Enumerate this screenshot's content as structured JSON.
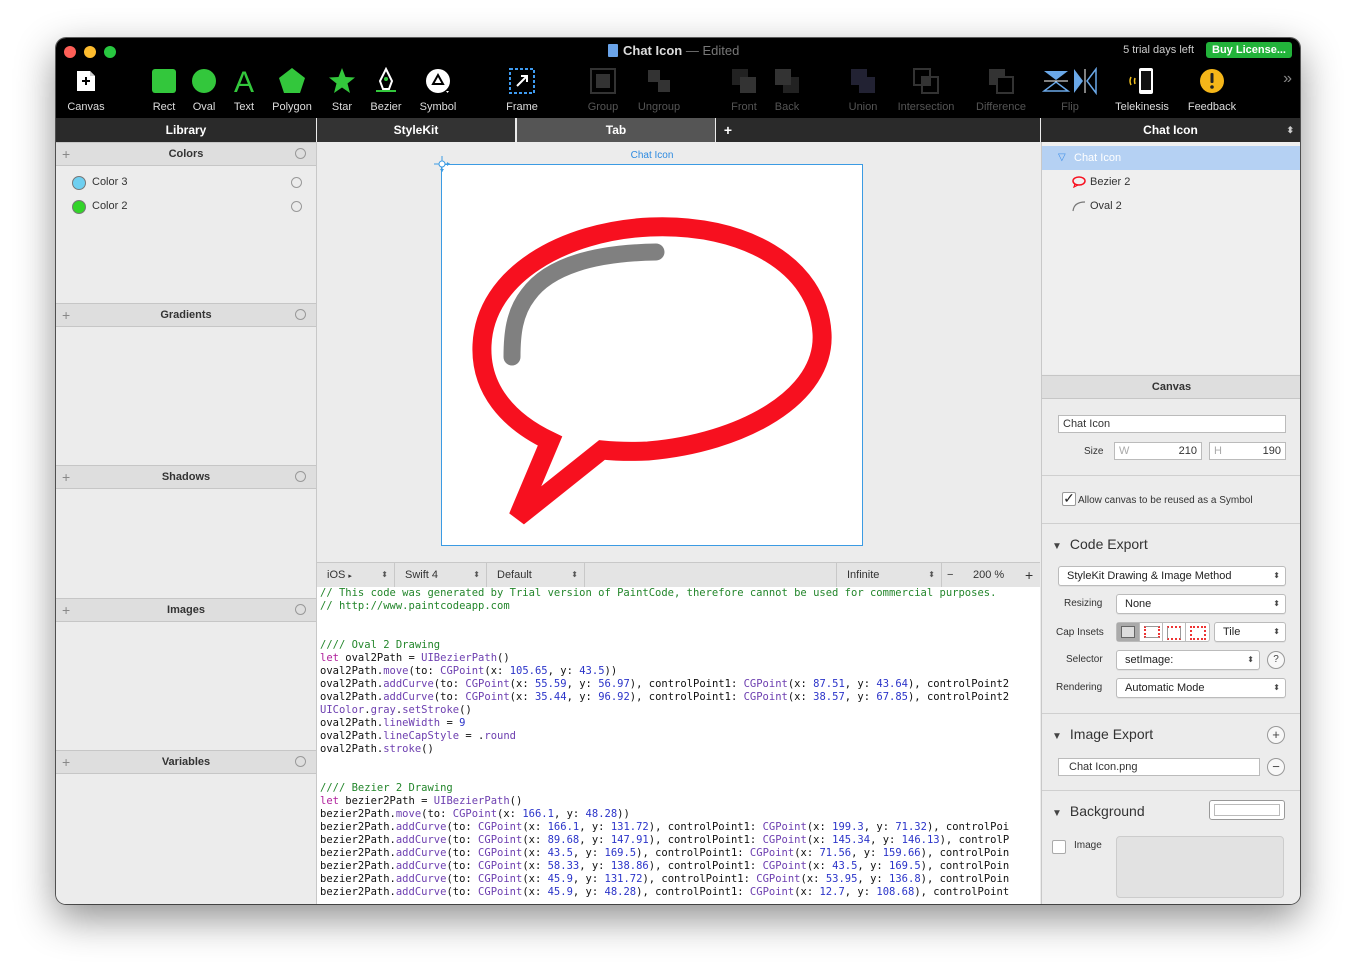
{
  "window": {
    "title": "Chat Icon",
    "title_sep": "—",
    "edited": "Edited",
    "trial": "5 trial days left",
    "buy": "Buy License..."
  },
  "toolbar": {
    "tools": [
      {
        "label": "Canvas",
        "icon": "canvas-icon"
      },
      {
        "label": "Rect",
        "icon": "rect-icon"
      },
      {
        "label": "Oval",
        "icon": "oval-icon"
      },
      {
        "label": "Text",
        "icon": "text-icon"
      },
      {
        "label": "Polygon",
        "icon": "polygon-icon"
      },
      {
        "label": "Star",
        "icon": "star-icon"
      },
      {
        "label": "Bezier",
        "icon": "bezier-pen-icon"
      },
      {
        "label": "Symbol",
        "icon": "symbol-icon"
      },
      {
        "label": "Frame",
        "icon": "frame-icon"
      },
      {
        "label": "Group",
        "icon": "group-icon"
      },
      {
        "label": "Ungroup",
        "icon": "ungroup-icon"
      },
      {
        "label": "Front",
        "icon": "bring-front-icon"
      },
      {
        "label": "Back",
        "icon": "send-back-icon"
      },
      {
        "label": "Union",
        "icon": "union-icon"
      },
      {
        "label": "Intersection",
        "icon": "intersection-icon"
      },
      {
        "label": "Difference",
        "icon": "difference-icon"
      },
      {
        "label": "Flip",
        "icon": "flip-icon"
      },
      {
        "label": "Telekinesis",
        "icon": "telekinesis-icon"
      },
      {
        "label": "Feedback",
        "icon": "feedback-icon"
      }
    ],
    "overflow": "»"
  },
  "tabs": {
    "library": "Library",
    "stylekit": "StyleKit",
    "tab": "Tab",
    "add": "+",
    "inspector": "Chat Icon",
    "inspector_arrows": "⬍"
  },
  "library": {
    "colors_title": "Colors",
    "colors": [
      {
        "name": "Color 3",
        "color": "#6ecff0"
      },
      {
        "name": "Color 2",
        "color": "#33d42a"
      }
    ],
    "gradients_title": "Gradients",
    "shadows_title": "Shadows",
    "images_title": "Images",
    "variables_title": "Variables",
    "plus": "+"
  },
  "canvas": {
    "label": "Chat Icon",
    "bubble_color": "#f7101f",
    "highlight_color": "#808080"
  },
  "codebar": {
    "platform": "iOS",
    "platform_arrow": "▸",
    "language": "Swift 4",
    "style": "Default",
    "range": "Infinite",
    "minus": "−",
    "zoom": "200 %",
    "plus": "+",
    "arrows": "⬍"
  },
  "code": {
    "lines": [
      [
        {
          "t": "// This code was generated by Trial version of PaintCode, therefore cannot be used for commercial purposes.",
          "c": "com"
        }
      ],
      [
        {
          "t": "// http://www.paintcodeapp.com",
          "c": "com"
        }
      ],
      [],
      [],
      [
        {
          "t": "//// Oval 2 Drawing",
          "c": "com"
        }
      ],
      [
        {
          "t": "let",
          "c": "kw"
        },
        {
          "t": " oval2Path = ",
          "c": "plain"
        },
        {
          "t": "UIBezierPath",
          "c": "ty"
        },
        {
          "t": "()",
          "c": "plain"
        }
      ],
      [
        {
          "t": "oval2Path.",
          "c": "plain"
        },
        {
          "t": "move",
          "c": "ty"
        },
        {
          "t": "(to: ",
          "c": "plain"
        },
        {
          "t": "CGPoint",
          "c": "ty"
        },
        {
          "t": "(x: ",
          "c": "plain"
        },
        {
          "t": "105.65",
          "c": "num"
        },
        {
          "t": ", y: ",
          "c": "plain"
        },
        {
          "t": "43.5",
          "c": "num"
        },
        {
          "t": "))",
          "c": "plain"
        }
      ],
      [
        {
          "t": "oval2Path.",
          "c": "plain"
        },
        {
          "t": "addCurve",
          "c": "ty"
        },
        {
          "t": "(to: ",
          "c": "plain"
        },
        {
          "t": "CGPoint",
          "c": "ty"
        },
        {
          "t": "(x: ",
          "c": "plain"
        },
        {
          "t": "55.59",
          "c": "num"
        },
        {
          "t": ", y: ",
          "c": "plain"
        },
        {
          "t": "56.97",
          "c": "num"
        },
        {
          "t": "), controlPoint1: ",
          "c": "plain"
        },
        {
          "t": "CGPoint",
          "c": "ty"
        },
        {
          "t": "(x: ",
          "c": "plain"
        },
        {
          "t": "87.51",
          "c": "num"
        },
        {
          "t": ", y: ",
          "c": "plain"
        },
        {
          "t": "43.64",
          "c": "num"
        },
        {
          "t": "), controlPoint2",
          "c": "plain"
        }
      ],
      [
        {
          "t": "oval2Path.",
          "c": "plain"
        },
        {
          "t": "addCurve",
          "c": "ty"
        },
        {
          "t": "(to: ",
          "c": "plain"
        },
        {
          "t": "CGPoint",
          "c": "ty"
        },
        {
          "t": "(x: ",
          "c": "plain"
        },
        {
          "t": "35.44",
          "c": "num"
        },
        {
          "t": ", y: ",
          "c": "plain"
        },
        {
          "t": "96.92",
          "c": "num"
        },
        {
          "t": "), controlPoint1: ",
          "c": "plain"
        },
        {
          "t": "CGPoint",
          "c": "ty"
        },
        {
          "t": "(x: ",
          "c": "plain"
        },
        {
          "t": "38.57",
          "c": "num"
        },
        {
          "t": ", y: ",
          "c": "plain"
        },
        {
          "t": "67.85",
          "c": "num"
        },
        {
          "t": "), controlPoint2",
          "c": "plain"
        }
      ],
      [
        {
          "t": "UIColor",
          "c": "ty"
        },
        {
          "t": ".",
          "c": "plain"
        },
        {
          "t": "gray",
          "c": "ty"
        },
        {
          "t": ".",
          "c": "plain"
        },
        {
          "t": "setStroke",
          "c": "ty"
        },
        {
          "t": "()",
          "c": "plain"
        }
      ],
      [
        {
          "t": "oval2Path.",
          "c": "plain"
        },
        {
          "t": "lineWidth",
          "c": "ty"
        },
        {
          "t": " = ",
          "c": "plain"
        },
        {
          "t": "9",
          "c": "num"
        }
      ],
      [
        {
          "t": "oval2Path.",
          "c": "plain"
        },
        {
          "t": "lineCapStyle",
          "c": "ty"
        },
        {
          "t": " = .",
          "c": "plain"
        },
        {
          "t": "round",
          "c": "ty"
        }
      ],
      [
        {
          "t": "oval2Path.",
          "c": "plain"
        },
        {
          "t": "stroke",
          "c": "ty"
        },
        {
          "t": "()",
          "c": "plain"
        }
      ],
      [],
      [],
      [
        {
          "t": "//// Bezier 2 Drawing",
          "c": "com"
        }
      ],
      [
        {
          "t": "let",
          "c": "kw"
        },
        {
          "t": " bezier2Path = ",
          "c": "plain"
        },
        {
          "t": "UIBezierPath",
          "c": "ty"
        },
        {
          "t": "()",
          "c": "plain"
        }
      ],
      [
        {
          "t": "bezier2Path.",
          "c": "plain"
        },
        {
          "t": "move",
          "c": "ty"
        },
        {
          "t": "(to: ",
          "c": "plain"
        },
        {
          "t": "CGPoint",
          "c": "ty"
        },
        {
          "t": "(x: ",
          "c": "plain"
        },
        {
          "t": "166.1",
          "c": "num"
        },
        {
          "t": ", y: ",
          "c": "plain"
        },
        {
          "t": "48.28",
          "c": "num"
        },
        {
          "t": "))",
          "c": "plain"
        }
      ],
      [
        {
          "t": "bezier2Path.",
          "c": "plain"
        },
        {
          "t": "addCurve",
          "c": "ty"
        },
        {
          "t": "(to: ",
          "c": "plain"
        },
        {
          "t": "CGPoint",
          "c": "ty"
        },
        {
          "t": "(x: ",
          "c": "plain"
        },
        {
          "t": "166.1",
          "c": "num"
        },
        {
          "t": ", y: ",
          "c": "plain"
        },
        {
          "t": "131.72",
          "c": "num"
        },
        {
          "t": "), controlPoint1: ",
          "c": "plain"
        },
        {
          "t": "CGPoint",
          "c": "ty"
        },
        {
          "t": "(x: ",
          "c": "plain"
        },
        {
          "t": "199.3",
          "c": "num"
        },
        {
          "t": ", y: ",
          "c": "plain"
        },
        {
          "t": "71.32",
          "c": "num"
        },
        {
          "t": "), controlPoi",
          "c": "plain"
        }
      ],
      [
        {
          "t": "bezier2Path.",
          "c": "plain"
        },
        {
          "t": "addCurve",
          "c": "ty"
        },
        {
          "t": "(to: ",
          "c": "plain"
        },
        {
          "t": "CGPoint",
          "c": "ty"
        },
        {
          "t": "(x: ",
          "c": "plain"
        },
        {
          "t": "89.68",
          "c": "num"
        },
        {
          "t": ", y: ",
          "c": "plain"
        },
        {
          "t": "147.91",
          "c": "num"
        },
        {
          "t": "), controlPoint1: ",
          "c": "plain"
        },
        {
          "t": "CGPoint",
          "c": "ty"
        },
        {
          "t": "(x: ",
          "c": "plain"
        },
        {
          "t": "145.34",
          "c": "num"
        },
        {
          "t": ", y: ",
          "c": "plain"
        },
        {
          "t": "146.13",
          "c": "num"
        },
        {
          "t": "), controlP",
          "c": "plain"
        }
      ],
      [
        {
          "t": "bezier2Path.",
          "c": "plain"
        },
        {
          "t": "addCurve",
          "c": "ty"
        },
        {
          "t": "(to: ",
          "c": "plain"
        },
        {
          "t": "CGPoint",
          "c": "ty"
        },
        {
          "t": "(x: ",
          "c": "plain"
        },
        {
          "t": "43.5",
          "c": "num"
        },
        {
          "t": ", y: ",
          "c": "plain"
        },
        {
          "t": "169.5",
          "c": "num"
        },
        {
          "t": "), controlPoint1: ",
          "c": "plain"
        },
        {
          "t": "CGPoint",
          "c": "ty"
        },
        {
          "t": "(x: ",
          "c": "plain"
        },
        {
          "t": "71.56",
          "c": "num"
        },
        {
          "t": ", y: ",
          "c": "plain"
        },
        {
          "t": "159.66",
          "c": "num"
        },
        {
          "t": "), controlPoin",
          "c": "plain"
        }
      ],
      [
        {
          "t": "bezier2Path.",
          "c": "plain"
        },
        {
          "t": "addCurve",
          "c": "ty"
        },
        {
          "t": "(to: ",
          "c": "plain"
        },
        {
          "t": "CGPoint",
          "c": "ty"
        },
        {
          "t": "(x: ",
          "c": "plain"
        },
        {
          "t": "58.33",
          "c": "num"
        },
        {
          "t": ", y: ",
          "c": "plain"
        },
        {
          "t": "138.86",
          "c": "num"
        },
        {
          "t": "), controlPoint1: ",
          "c": "plain"
        },
        {
          "t": "CGPoint",
          "c": "ty"
        },
        {
          "t": "(x: ",
          "c": "plain"
        },
        {
          "t": "43.5",
          "c": "num"
        },
        {
          "t": ", y: ",
          "c": "plain"
        },
        {
          "t": "169.5",
          "c": "num"
        },
        {
          "t": "), controlPoin",
          "c": "plain"
        }
      ],
      [
        {
          "t": "bezier2Path.",
          "c": "plain"
        },
        {
          "t": "addCurve",
          "c": "ty"
        },
        {
          "t": "(to: ",
          "c": "plain"
        },
        {
          "t": "CGPoint",
          "c": "ty"
        },
        {
          "t": "(x: ",
          "c": "plain"
        },
        {
          "t": "45.9",
          "c": "num"
        },
        {
          "t": ", y: ",
          "c": "plain"
        },
        {
          "t": "131.72",
          "c": "num"
        },
        {
          "t": "), controlPoint1: ",
          "c": "plain"
        },
        {
          "t": "CGPoint",
          "c": "ty"
        },
        {
          "t": "(x: ",
          "c": "plain"
        },
        {
          "t": "53.95",
          "c": "num"
        },
        {
          "t": ", y: ",
          "c": "plain"
        },
        {
          "t": "136.8",
          "c": "num"
        },
        {
          "t": "), controlPoin",
          "c": "plain"
        }
      ],
      [
        {
          "t": "bezier2Path.",
          "c": "plain"
        },
        {
          "t": "addCurve",
          "c": "ty"
        },
        {
          "t": "(to: ",
          "c": "plain"
        },
        {
          "t": "CGPoint",
          "c": "ty"
        },
        {
          "t": "(x: ",
          "c": "plain"
        },
        {
          "t": "45.9",
          "c": "num"
        },
        {
          "t": ", y: ",
          "c": "plain"
        },
        {
          "t": "48.28",
          "c": "num"
        },
        {
          "t": "), controlPoint1: ",
          "c": "plain"
        },
        {
          "t": "CGPoint",
          "c": "ty"
        },
        {
          "t": "(x: ",
          "c": "plain"
        },
        {
          "t": "12.7",
          "c": "num"
        },
        {
          "t": ", y: ",
          "c": "plain"
        },
        {
          "t": "108.68",
          "c": "num"
        },
        {
          "t": "), controlPoint",
          "c": "plain"
        }
      ]
    ]
  },
  "inspector": {
    "layers": [
      {
        "name": "Chat Icon",
        "icon": "canvas-triangle-icon",
        "selected": true
      },
      {
        "name": "Bezier 2",
        "icon": "speech-bubble-icon",
        "selected": false
      },
      {
        "name": "Oval 2",
        "icon": "arc-icon",
        "selected": false
      }
    ],
    "canvas_title": "Canvas",
    "canvas_name": "Chat Icon",
    "size_label": "Size",
    "w_label": "W",
    "w": "210",
    "h_label": "H",
    "h": "190",
    "reuse_label": "Allow canvas to be reused as a Symbol",
    "reuse_checked": true,
    "code_export_title": "Code Export",
    "export_method": "StyleKit Drawing & Image Method",
    "resizing_label": "Resizing",
    "resizing": "None",
    "cap_insets_label": "Cap Insets",
    "cap_mode": "Tile",
    "selector_label": "Selector",
    "selector": "setImage:",
    "help": "?",
    "rendering_label": "Rendering",
    "rendering": "Automatic Mode",
    "image_export_title": "Image Export",
    "image_file": "Chat Icon.png",
    "plus": "+",
    "minus": "−",
    "background_title": "Background",
    "image_label": "Image",
    "triangle": "▼"
  }
}
